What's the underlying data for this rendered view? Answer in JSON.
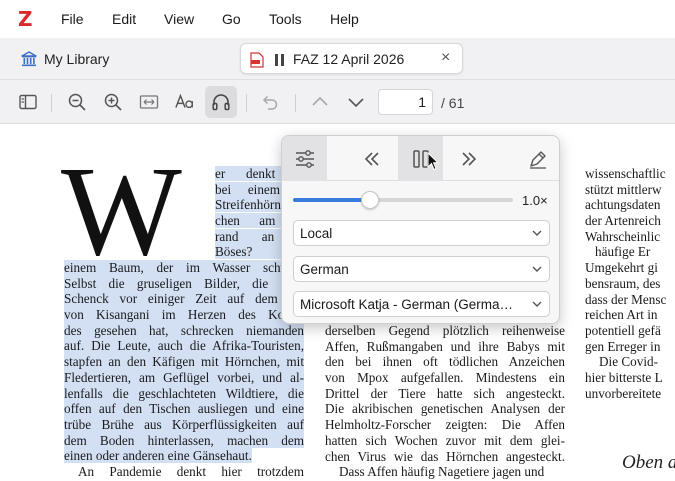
{
  "app": {
    "logo": "Z",
    "menu": [
      "File",
      "Edit",
      "View",
      "Go",
      "Tools",
      "Help"
    ]
  },
  "tabs": {
    "library_label": "My Library",
    "document_title": "FAZ 12 April 2026",
    "close_glyph": "×"
  },
  "toolbar": {
    "current_page": "1",
    "page_total": "/ 61"
  },
  "read_aloud": {
    "speed_value": "1.0×",
    "speed_fraction": 0.35,
    "source": "Local",
    "language": "German",
    "voice": "Microsoft Katja - German (Germa…"
  },
  "colors": {
    "accent": "#3b7ddd",
    "highlight": "#d3e0f4",
    "logo": "#d92b2b"
  },
  "icons": [
    "library-icon",
    "pdf-icon",
    "pause-icon",
    "sidebar-icon",
    "zoom-out-icon",
    "zoom-in-icon",
    "fit-width-icon",
    "appearance-icon",
    "headphones-icon",
    "undo-icon",
    "chevron-up-icon",
    "chevron-down-icon",
    "settings-sliders-icon",
    "skip-back-icon",
    "pause-icon",
    "skip-forward-icon",
    "annotate-pen-icon"
  ],
  "document": {
    "drop_cap": "W",
    "col1_right": [
      "er denkt sc",
      "bei einem to",
      "Streifenhörn",
      "chen am W",
      "rand an et",
      "Böses? Wer"
    ],
    "col1_main": [
      "einem Baum, der im Wasser schwim",
      "Selbst die gruseligen Bilder, die Chri",
      "Schenck vor einiger Zeit auf dem Mi",
      "von Kisangani im Herzen des Kongo",
      "des gesehen hat, schrecken niemanden",
      "auf. Die Leute, auch die Afrika-Touristen,",
      "stapfen an den Käfigen mit Hörnchen, mit",
      "Fledertieren, am Geflügel vorbei, und al-",
      "lenfalls die geschlachteten Wildtiere, die",
      "offen auf den Tischen ausliegen und eine",
      "trübe Brühe aus Körperflüssigkeiten auf",
      "dem Boden hinterlassen, machen dem",
      "einen oder anderen eine Gänsehaut.",
      "An Pandemie denkt hier trotzdem"
    ],
    "col2": [
      "derselben Gegend plötzlich reihenweise",
      "Affen, Rußmangaben und ihre Babys mit",
      "den bei ihnen oft tödlichen Anzeichen",
      "von Mpox aufgefallen. Mindestens ein",
      "Drittel der Tiere hatte sich angesteckt.",
      "Die akribischen genetischen Analysen der",
      "Helmholtz-Forscher zeigten: Die Affen",
      "hatten sich Wochen zuvor mit dem glei-",
      "chen Virus wie das Hörnchen angesteckt.",
      "Dass Affen häufig Nagetiere jagen und"
    ],
    "col3": [
      "wissenschaftlic",
      "stützt mittlerw",
      "achtungsdaten",
      "der Artenreich",
      "Wahrscheinlic",
      "häufige Er",
      "Umgekehrt gi",
      "bensraum, des",
      "dass der Mensc",
      "reichen Art in",
      "potentiell gefä",
      "gen Erreger in",
      "Die Covid-",
      "hier bitterste L",
      "unvorbereitete"
    ],
    "col3_heading": "Oben a"
  }
}
